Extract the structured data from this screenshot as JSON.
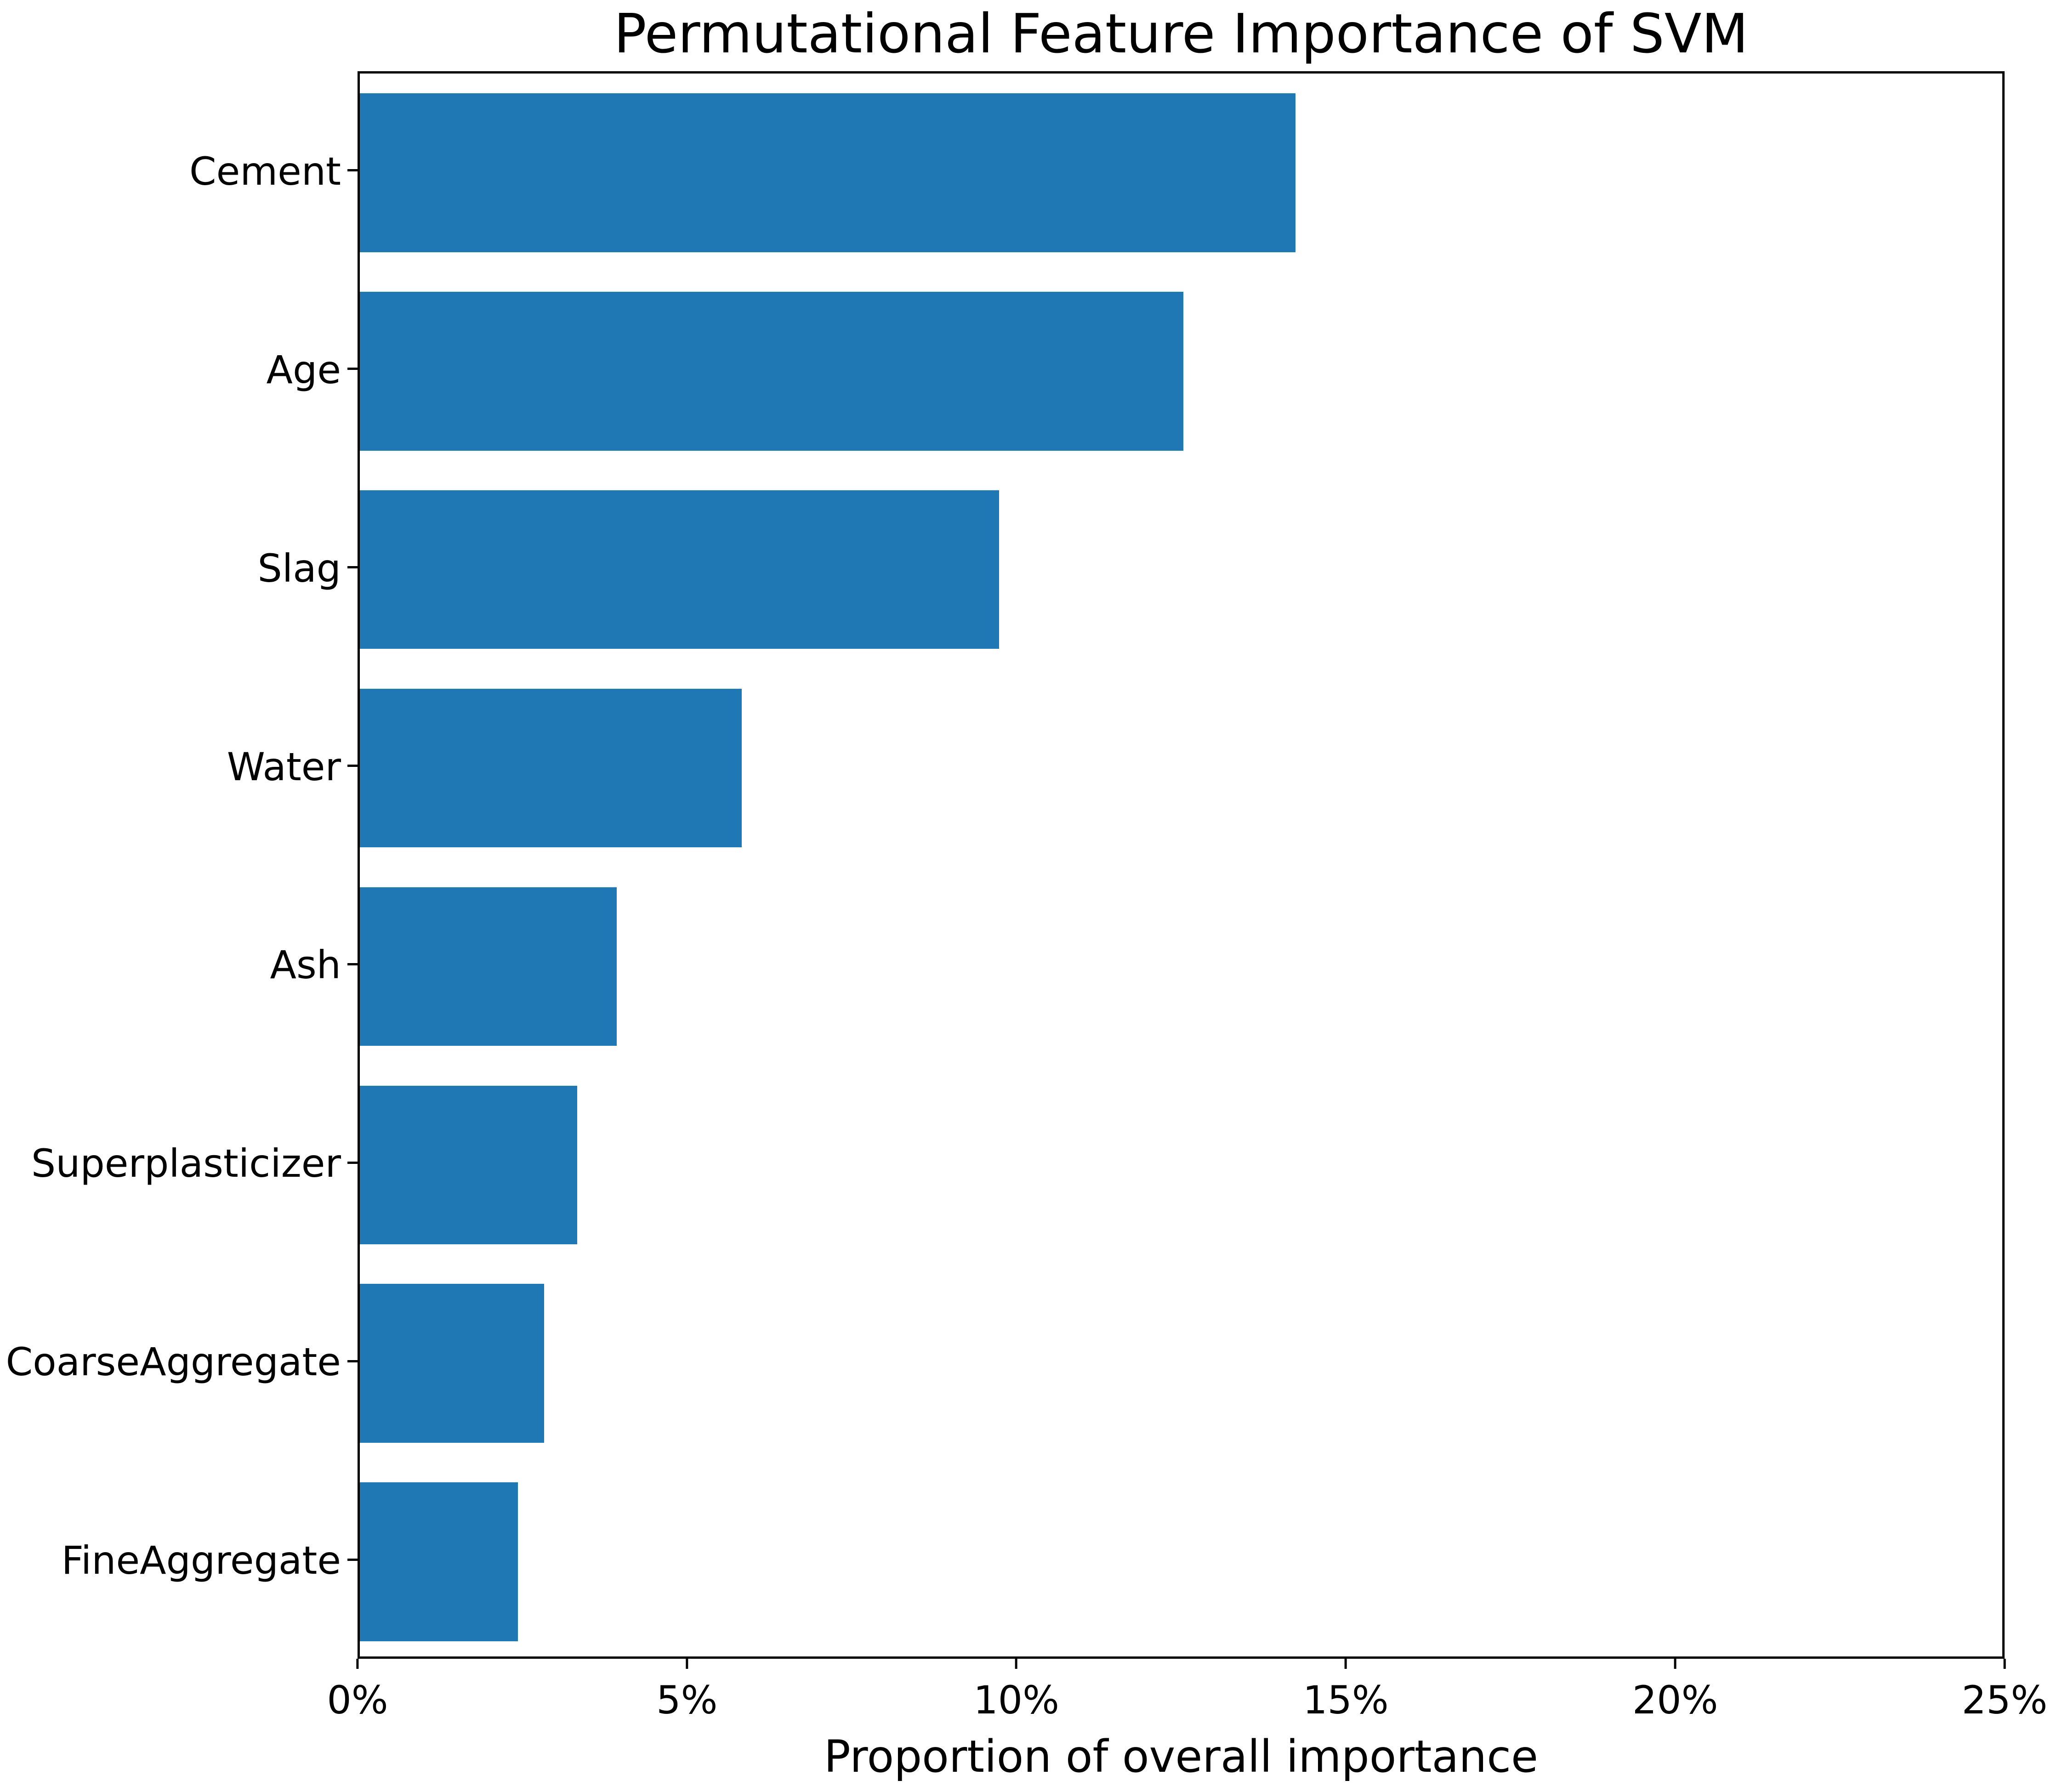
{
  "chart_data": {
    "type": "bar",
    "orientation": "horizontal",
    "title": "Permutational Feature Importance of SVM",
    "xlabel": "Proportion of overall importance",
    "ylabel": "",
    "categories": [
      "Cement",
      "Age",
      "Slag",
      "Water",
      "Ash",
      "Superplasticizer",
      "CoarseAggregate",
      "FineAggregate"
    ],
    "values": [
      14.2,
      12.5,
      9.7,
      5.8,
      3.9,
      3.3,
      2.8,
      2.4
    ],
    "value_unit": "%",
    "xlim": [
      0,
      25
    ],
    "ylim": [
      0,
      8
    ],
    "x_tick_labels": [
      "0%",
      "5%",
      "10%",
      "15%",
      "20%",
      "25%"
    ],
    "x_tick_values": [
      0,
      5,
      10,
      15,
      20,
      25
    ],
    "grid": false,
    "legend": null,
    "bar_color": "#1f77b4",
    "axis_color": "#000000",
    "background_color": "#ffffff"
  },
  "figure": {
    "title": "Permutational Feature Importance of SVM",
    "x_axis_label": "Proportion of overall importance"
  }
}
